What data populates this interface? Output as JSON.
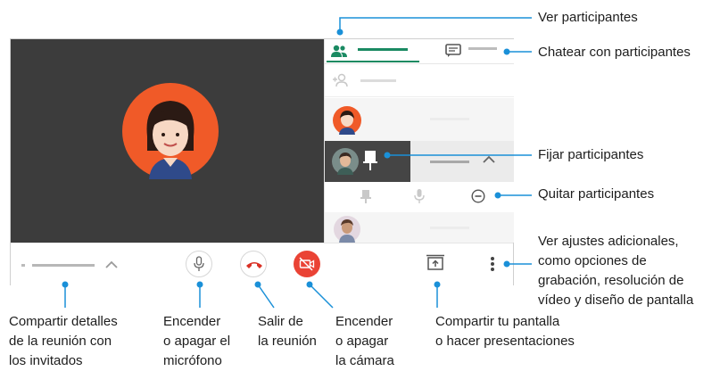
{
  "annotations": {
    "ver_participantes": "Ver participantes",
    "chatear": "Chatear con participantes",
    "fijar": "Fijar participantes",
    "quitar": "Quitar participantes",
    "ajustes": "Ver ajustes adicionales,\ncomo opciones de\ngrabación, resolución de\nvídeo y diseño de pantalla",
    "compartir_detalles": "Compartir detalles\nde la reunión con\nlos invitados",
    "microfono": "Encender\no apagar el\nmicrófono",
    "salir": "Salir de\nla reunión",
    "camara": "Encender\no apagar\nla cámara",
    "pantalla": "Compartir tu pantalla\no hacer presentaciones"
  },
  "icons": {
    "people": "people-icon",
    "chat": "chat-icon",
    "add_person": "add-person-icon",
    "pin": "pin-icon",
    "mic": "mic-icon",
    "remove": "remove-circle-icon",
    "hangup": "phone-hangup-icon",
    "camera_off": "camera-off-icon",
    "present": "present-screen-icon",
    "more": "more-vert-icon",
    "chevron_up": "chevron-up-icon"
  },
  "colors": {
    "accent_green": "#1a8a62",
    "hangup_red": "#d93025",
    "camera_red": "#ea4335",
    "callout_blue": "#1a90d8",
    "avatar_orange": "#f05a28"
  }
}
